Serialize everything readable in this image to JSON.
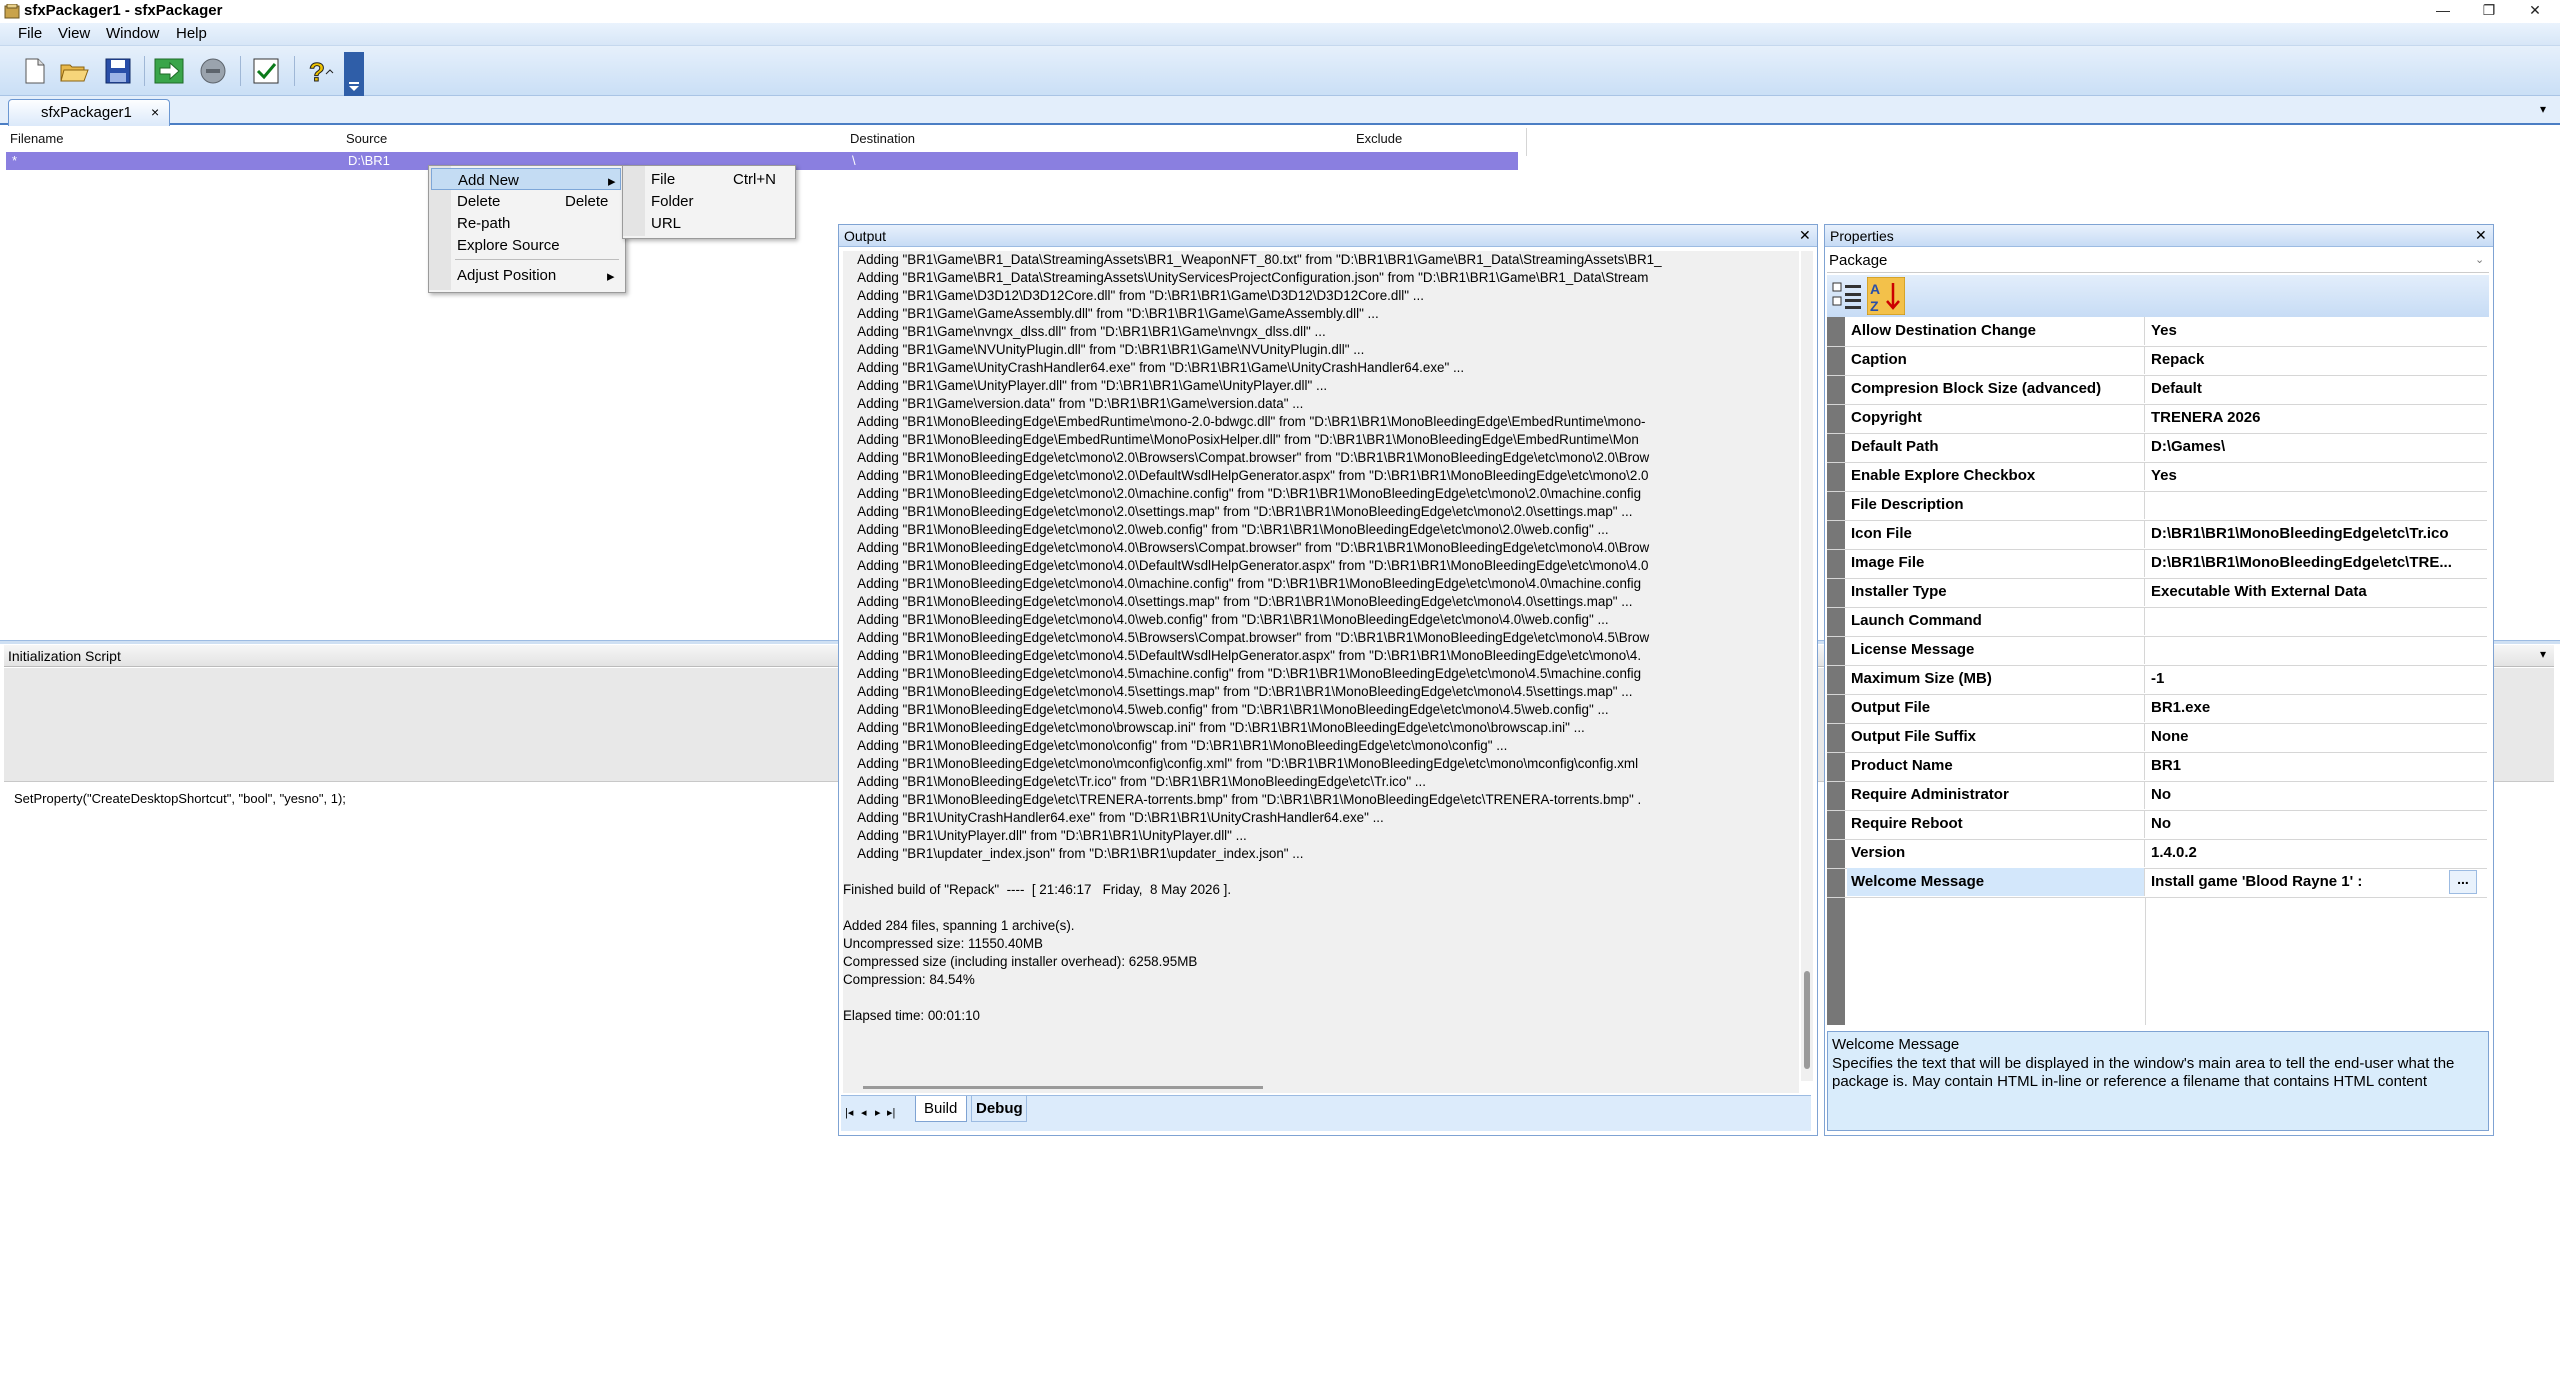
{
  "window": {
    "title": "sfxPackager1 - sfxPackager"
  },
  "menu": [
    "File",
    "View",
    "Window",
    "Help"
  ],
  "toolbar": {
    "buttons": [
      "new-icon",
      "open-icon",
      "save-icon",
      "build-icon",
      "stop-icon",
      "check-icon",
      "help-icon"
    ]
  },
  "doc_tab": {
    "label": "sfxPackager1",
    "close": "×"
  },
  "grid": {
    "columns": [
      "Filename",
      "Source",
      "Destination",
      "Exclude"
    ],
    "row": {
      "filename": "*",
      "source": "D:\\BR1",
      "destination": "\\",
      "exclude": ""
    }
  },
  "context_menu": {
    "add_new": "Add New",
    "delete": "Delete",
    "delete_shortcut": "Delete",
    "repath": "Re-path",
    "explore_source": "Explore Source",
    "adjust_position": "Adjust Position"
  },
  "submenu": {
    "file": "File",
    "file_shortcut": "Ctrl+N",
    "folder": "Folder",
    "url": "URL"
  },
  "init_script": {
    "title": "Initialization Script",
    "code": "SetProperty(\"CreateDesktopShortcut\", \"bool\", \"yesno\", 1);"
  },
  "output": {
    "title": "Output",
    "lines": [
      "    Adding \"BR1\\Game\\BR1_Data\\StreamingAssets\\BR1_WeaponNFT_80.txt\" from \"D:\\BR1\\BR1\\Game\\BR1_Data\\StreamingAssets\\BR1_",
      "    Adding \"BR1\\Game\\BR1_Data\\StreamingAssets\\UnityServicesProjectConfiguration.json\" from \"D:\\BR1\\BR1\\Game\\BR1_Data\\Stream",
      "    Adding \"BR1\\Game\\D3D12\\D3D12Core.dll\" from \"D:\\BR1\\BR1\\Game\\D3D12\\D3D12Core.dll\" ...",
      "    Adding \"BR1\\Game\\GameAssembly.dll\" from \"D:\\BR1\\BR1\\Game\\GameAssembly.dll\" ...",
      "    Adding \"BR1\\Game\\nvngx_dlss.dll\" from \"D:\\BR1\\BR1\\Game\\nvngx_dlss.dll\" ...",
      "    Adding \"BR1\\Game\\NVUnityPlugin.dll\" from \"D:\\BR1\\BR1\\Game\\NVUnityPlugin.dll\" ...",
      "    Adding \"BR1\\Game\\UnityCrashHandler64.exe\" from \"D:\\BR1\\BR1\\Game\\UnityCrashHandler64.exe\" ...",
      "    Adding \"BR1\\Game\\UnityPlayer.dll\" from \"D:\\BR1\\BR1\\Game\\UnityPlayer.dll\" ...",
      "    Adding \"BR1\\Game\\version.data\" from \"D:\\BR1\\BR1\\Game\\version.data\" ...",
      "    Adding \"BR1\\MonoBleedingEdge\\EmbedRuntime\\mono-2.0-bdwgc.dll\" from \"D:\\BR1\\BR1\\MonoBleedingEdge\\EmbedRuntime\\mono-",
      "    Adding \"BR1\\MonoBleedingEdge\\EmbedRuntime\\MonoPosixHelper.dll\" from \"D:\\BR1\\BR1\\MonoBleedingEdge\\EmbedRuntime\\Mon",
      "    Adding \"BR1\\MonoBleedingEdge\\etc\\mono\\2.0\\Browsers\\Compat.browser\" from \"D:\\BR1\\BR1\\MonoBleedingEdge\\etc\\mono\\2.0\\Brow",
      "    Adding \"BR1\\MonoBleedingEdge\\etc\\mono\\2.0\\DefaultWsdlHelpGenerator.aspx\" from \"D:\\BR1\\BR1\\MonoBleedingEdge\\etc\\mono\\2.0",
      "    Adding \"BR1\\MonoBleedingEdge\\etc\\mono\\2.0\\machine.config\" from \"D:\\BR1\\BR1\\MonoBleedingEdge\\etc\\mono\\2.0\\machine.config",
      "    Adding \"BR1\\MonoBleedingEdge\\etc\\mono\\2.0\\settings.map\" from \"D:\\BR1\\BR1\\MonoBleedingEdge\\etc\\mono\\2.0\\settings.map\" ...",
      "    Adding \"BR1\\MonoBleedingEdge\\etc\\mono\\2.0\\web.config\" from \"D:\\BR1\\BR1\\MonoBleedingEdge\\etc\\mono\\2.0\\web.config\" ...",
      "    Adding \"BR1\\MonoBleedingEdge\\etc\\mono\\4.0\\Browsers\\Compat.browser\" from \"D:\\BR1\\BR1\\MonoBleedingEdge\\etc\\mono\\4.0\\Brow",
      "    Adding \"BR1\\MonoBleedingEdge\\etc\\mono\\4.0\\DefaultWsdlHelpGenerator.aspx\" from \"D:\\BR1\\BR1\\MonoBleedingEdge\\etc\\mono\\4.0",
      "    Adding \"BR1\\MonoBleedingEdge\\etc\\mono\\4.0\\machine.config\" from \"D:\\BR1\\BR1\\MonoBleedingEdge\\etc\\mono\\4.0\\machine.config",
      "    Adding \"BR1\\MonoBleedingEdge\\etc\\mono\\4.0\\settings.map\" from \"D:\\BR1\\BR1\\MonoBleedingEdge\\etc\\mono\\4.0\\settings.map\" ...",
      "    Adding \"BR1\\MonoBleedingEdge\\etc\\mono\\4.0\\web.config\" from \"D:\\BR1\\BR1\\MonoBleedingEdge\\etc\\mono\\4.0\\web.config\" ...",
      "    Adding \"BR1\\MonoBleedingEdge\\etc\\mono\\4.5\\Browsers\\Compat.browser\" from \"D:\\BR1\\BR1\\MonoBleedingEdge\\etc\\mono\\4.5\\Brow",
      "    Adding \"BR1\\MonoBleedingEdge\\etc\\mono\\4.5\\DefaultWsdlHelpGenerator.aspx\" from \"D:\\BR1\\BR1\\MonoBleedingEdge\\etc\\mono\\4.",
      "    Adding \"BR1\\MonoBleedingEdge\\etc\\mono\\4.5\\machine.config\" from \"D:\\BR1\\BR1\\MonoBleedingEdge\\etc\\mono\\4.5\\machine.config",
      "    Adding \"BR1\\MonoBleedingEdge\\etc\\mono\\4.5\\settings.map\" from \"D:\\BR1\\BR1\\MonoBleedingEdge\\etc\\mono\\4.5\\settings.map\" ...",
      "    Adding \"BR1\\MonoBleedingEdge\\etc\\mono\\4.5\\web.config\" from \"D:\\BR1\\BR1\\MonoBleedingEdge\\etc\\mono\\4.5\\web.config\" ...",
      "    Adding \"BR1\\MonoBleedingEdge\\etc\\mono\\browscap.ini\" from \"D:\\BR1\\BR1\\MonoBleedingEdge\\etc\\mono\\browscap.ini\" ...",
      "    Adding \"BR1\\MonoBleedingEdge\\etc\\mono\\config\" from \"D:\\BR1\\BR1\\MonoBleedingEdge\\etc\\mono\\config\" ...",
      "    Adding \"BR1\\MonoBleedingEdge\\etc\\mono\\mconfig\\config.xml\" from \"D:\\BR1\\BR1\\MonoBleedingEdge\\etc\\mono\\mconfig\\config.xml",
      "    Adding \"BR1\\MonoBleedingEdge\\etc\\Tr.ico\" from \"D:\\BR1\\BR1\\MonoBleedingEdge\\etc\\Tr.ico\" ...",
      "    Adding \"BR1\\MonoBleedingEdge\\etc\\TRENERA-torrents.bmp\" from \"D:\\BR1\\BR1\\MonoBleedingEdge\\etc\\TRENERA-torrents.bmp\" .",
      "    Adding \"BR1\\UnityCrashHandler64.exe\" from \"D:\\BR1\\BR1\\UnityCrashHandler64.exe\" ...",
      "    Adding \"BR1\\UnityPlayer.dll\" from \"D:\\BR1\\BR1\\UnityPlayer.dll\" ...",
      "    Adding \"BR1\\updater_index.json\" from \"D:\\BR1\\BR1\\updater_index.json\" ...",
      "",
      "Finished build of \"Repack\"  ----  [ 21:46:17   Friday,  8 May 2026 ].",
      "",
      "Added 284 files, spanning 1 archive(s).",
      "Uncompressed size: 11550.40MB",
      "Compressed size (including installer overhead): 6258.95MB",
      "Compression: 84.54%",
      "",
      "Elapsed time: 00:01:10"
    ],
    "tabs": [
      "Build",
      "Debug"
    ],
    "nav": [
      "|◂",
      "◂",
      "▸",
      "▸|"
    ]
  },
  "properties": {
    "title": "Properties",
    "object": "Package",
    "rows": [
      {
        "name": "Allow Destination Change",
        "value": "Yes"
      },
      {
        "name": "Caption",
        "value": "Repack"
      },
      {
        "name": "Compresion Block Size (advanced)",
        "value": "Default"
      },
      {
        "name": "Copyright",
        "value": "TRENERA 2026"
      },
      {
        "name": "Default Path",
        "value": "D:\\Games\\"
      },
      {
        "name": "Enable Explore Checkbox",
        "value": "Yes"
      },
      {
        "name": "File Description",
        "value": ""
      },
      {
        "name": "Icon File",
        "value": "D:\\BR1\\BR1\\MonoBleedingEdge\\etc\\Tr.ico"
      },
      {
        "name": "Image File",
        "value": "D:\\BR1\\BR1\\MonoBleedingEdge\\etc\\TRE..."
      },
      {
        "name": "Installer Type",
        "value": "Executable With External Data"
      },
      {
        "name": "Launch Command",
        "value": ""
      },
      {
        "name": "License Message",
        "value": ""
      },
      {
        "name": "Maximum Size (MB)",
        "value": "-1"
      },
      {
        "name": "Output File",
        "value": "BR1.exe"
      },
      {
        "name": "Output File Suffix",
        "value": "None"
      },
      {
        "name": "Product Name",
        "value": "BR1"
      },
      {
        "name": "Require Administrator",
        "value": "No"
      },
      {
        "name": "Require Reboot",
        "value": "No"
      },
      {
        "name": "Version",
        "value": "1.4.0.2"
      },
      {
        "name": "Welcome Message",
        "value": "Install game 'Blood Rayne 1' :"
      }
    ],
    "selected_index": 19,
    "ellipsis": "...",
    "help_title": "Welcome Message",
    "help_text": "Specifies the text that will be displayed in the window's main area to tell the end-user what the package is. May contain HTML in-line or reference a filename that contains HTML content"
  },
  "colors": {
    "selection": "#8a7fe0",
    "panel_border": "#7fa3d3",
    "help_bg": "#d9ecfb"
  }
}
